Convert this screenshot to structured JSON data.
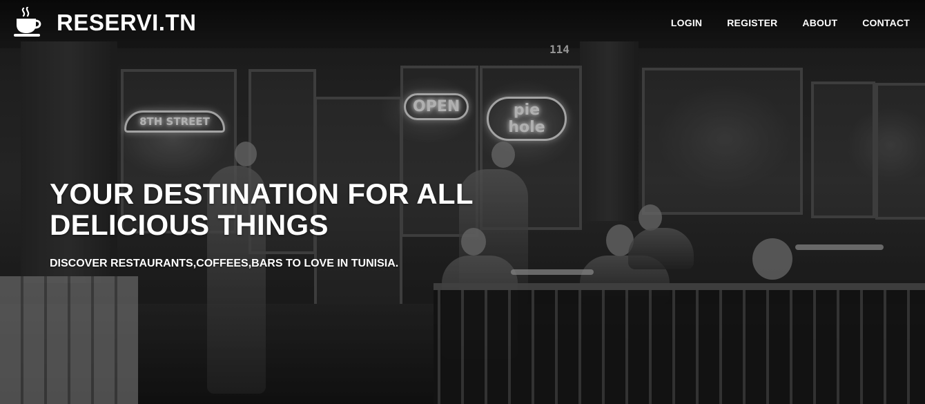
{
  "header": {
    "brand": "RESERVI.TN",
    "brand_icon": "coffee-cup-icon",
    "nav": {
      "login": "LOGIN",
      "register": "REGISTER",
      "about": "ABOUT",
      "contact": "CONTACT"
    }
  },
  "hero": {
    "title_line1": "YOUR DESTINATION FOR ALL",
    "title_line2": "DELICIOUS THINGS",
    "subtitle": "DISCOVER RESTAURANTS,COFFEES,BARS TO LOVE IN TUNISIA."
  },
  "scene": {
    "address_number": "114",
    "neon_open": "OPEN",
    "neon_pie": "pie hole",
    "neon_street": "8TH STREET"
  }
}
